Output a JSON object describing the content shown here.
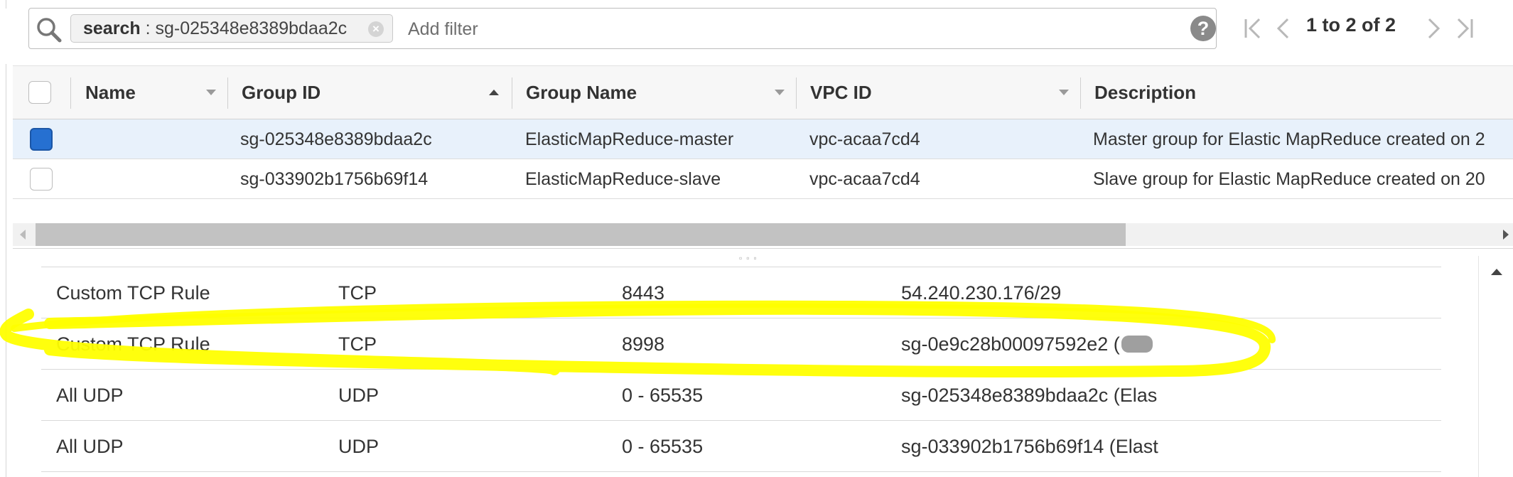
{
  "filter": {
    "token_key": "search",
    "token_separator": " : ",
    "token_value": "sg-025348e8389bdaa2c",
    "placeholder": "Add filter"
  },
  "pagination": {
    "range_text": "1 to 2 of 2"
  },
  "table": {
    "columns": [
      "Name",
      "Group ID",
      "Group Name",
      "VPC ID",
      "Description"
    ],
    "rows": [
      {
        "selected": true,
        "name": "",
        "group_id": "sg-025348e8389bdaa2c",
        "group_name": "ElasticMapReduce-master",
        "vpc_id": "vpc-acaa7cd4",
        "description": "Master group for Elastic MapReduce created on 2"
      },
      {
        "selected": false,
        "name": "",
        "group_id": "sg-033902b1756b69f14",
        "group_name": "ElasticMapReduce-slave",
        "vpc_id": "vpc-acaa7cd4",
        "description": "Slave group for Elastic MapReduce created on 20"
      }
    ]
  },
  "rules": [
    {
      "type": "Custom TCP Rule",
      "protocol": "TCP",
      "port_range": "8443",
      "source": "54.240.230.176/29"
    },
    {
      "type": "Custom TCP Rule",
      "protocol": "TCP",
      "port_range": "8998",
      "source": "sg-0e9c28b00097592e2 ("
    },
    {
      "type": "All UDP",
      "protocol": "UDP",
      "port_range": "0 - 65535",
      "source": "sg-025348e8389bdaa2c (Elas"
    },
    {
      "type": "All UDP",
      "protocol": "UDP",
      "port_range": "0 - 65535",
      "source": "sg-033902b1756b69f14 (Elast"
    }
  ],
  "colors": {
    "accent": "#2670d1",
    "selected_row": "#e8f1fb",
    "highlight": "#ffff00"
  }
}
